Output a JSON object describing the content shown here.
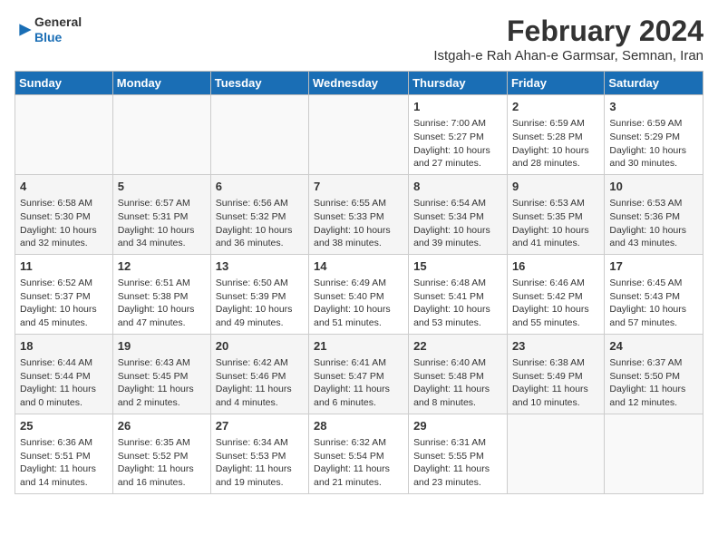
{
  "header": {
    "logo_line1": "General",
    "logo_line2": "Blue",
    "title": "February 2024",
    "subtitle": "Istgah-e Rah Ahan-e Garmsar, Semnan, Iran"
  },
  "weekdays": [
    "Sunday",
    "Monday",
    "Tuesday",
    "Wednesday",
    "Thursday",
    "Friday",
    "Saturday"
  ],
  "weeks": [
    [
      {
        "day": "",
        "info": ""
      },
      {
        "day": "",
        "info": ""
      },
      {
        "day": "",
        "info": ""
      },
      {
        "day": "",
        "info": ""
      },
      {
        "day": "1",
        "info": "Sunrise: 7:00 AM\nSunset: 5:27 PM\nDaylight: 10 hours\nand 27 minutes."
      },
      {
        "day": "2",
        "info": "Sunrise: 6:59 AM\nSunset: 5:28 PM\nDaylight: 10 hours\nand 28 minutes."
      },
      {
        "day": "3",
        "info": "Sunrise: 6:59 AM\nSunset: 5:29 PM\nDaylight: 10 hours\nand 30 minutes."
      }
    ],
    [
      {
        "day": "4",
        "info": "Sunrise: 6:58 AM\nSunset: 5:30 PM\nDaylight: 10 hours\nand 32 minutes."
      },
      {
        "day": "5",
        "info": "Sunrise: 6:57 AM\nSunset: 5:31 PM\nDaylight: 10 hours\nand 34 minutes."
      },
      {
        "day": "6",
        "info": "Sunrise: 6:56 AM\nSunset: 5:32 PM\nDaylight: 10 hours\nand 36 minutes."
      },
      {
        "day": "7",
        "info": "Sunrise: 6:55 AM\nSunset: 5:33 PM\nDaylight: 10 hours\nand 38 minutes."
      },
      {
        "day": "8",
        "info": "Sunrise: 6:54 AM\nSunset: 5:34 PM\nDaylight: 10 hours\nand 39 minutes."
      },
      {
        "day": "9",
        "info": "Sunrise: 6:53 AM\nSunset: 5:35 PM\nDaylight: 10 hours\nand 41 minutes."
      },
      {
        "day": "10",
        "info": "Sunrise: 6:53 AM\nSunset: 5:36 PM\nDaylight: 10 hours\nand 43 minutes."
      }
    ],
    [
      {
        "day": "11",
        "info": "Sunrise: 6:52 AM\nSunset: 5:37 PM\nDaylight: 10 hours\nand 45 minutes."
      },
      {
        "day": "12",
        "info": "Sunrise: 6:51 AM\nSunset: 5:38 PM\nDaylight: 10 hours\nand 47 minutes."
      },
      {
        "day": "13",
        "info": "Sunrise: 6:50 AM\nSunset: 5:39 PM\nDaylight: 10 hours\nand 49 minutes."
      },
      {
        "day": "14",
        "info": "Sunrise: 6:49 AM\nSunset: 5:40 PM\nDaylight: 10 hours\nand 51 minutes."
      },
      {
        "day": "15",
        "info": "Sunrise: 6:48 AM\nSunset: 5:41 PM\nDaylight: 10 hours\nand 53 minutes."
      },
      {
        "day": "16",
        "info": "Sunrise: 6:46 AM\nSunset: 5:42 PM\nDaylight: 10 hours\nand 55 minutes."
      },
      {
        "day": "17",
        "info": "Sunrise: 6:45 AM\nSunset: 5:43 PM\nDaylight: 10 hours\nand 57 minutes."
      }
    ],
    [
      {
        "day": "18",
        "info": "Sunrise: 6:44 AM\nSunset: 5:44 PM\nDaylight: 11 hours\nand 0 minutes."
      },
      {
        "day": "19",
        "info": "Sunrise: 6:43 AM\nSunset: 5:45 PM\nDaylight: 11 hours\nand 2 minutes."
      },
      {
        "day": "20",
        "info": "Sunrise: 6:42 AM\nSunset: 5:46 PM\nDaylight: 11 hours\nand 4 minutes."
      },
      {
        "day": "21",
        "info": "Sunrise: 6:41 AM\nSunset: 5:47 PM\nDaylight: 11 hours\nand 6 minutes."
      },
      {
        "day": "22",
        "info": "Sunrise: 6:40 AM\nSunset: 5:48 PM\nDaylight: 11 hours\nand 8 minutes."
      },
      {
        "day": "23",
        "info": "Sunrise: 6:38 AM\nSunset: 5:49 PM\nDaylight: 11 hours\nand 10 minutes."
      },
      {
        "day": "24",
        "info": "Sunrise: 6:37 AM\nSunset: 5:50 PM\nDaylight: 11 hours\nand 12 minutes."
      }
    ],
    [
      {
        "day": "25",
        "info": "Sunrise: 6:36 AM\nSunset: 5:51 PM\nDaylight: 11 hours\nand 14 minutes."
      },
      {
        "day": "26",
        "info": "Sunrise: 6:35 AM\nSunset: 5:52 PM\nDaylight: 11 hours\nand 16 minutes."
      },
      {
        "day": "27",
        "info": "Sunrise: 6:34 AM\nSunset: 5:53 PM\nDaylight: 11 hours\nand 19 minutes."
      },
      {
        "day": "28",
        "info": "Sunrise: 6:32 AM\nSunset: 5:54 PM\nDaylight: 11 hours\nand 21 minutes."
      },
      {
        "day": "29",
        "info": "Sunrise: 6:31 AM\nSunset: 5:55 PM\nDaylight: 11 hours\nand 23 minutes."
      },
      {
        "day": "",
        "info": ""
      },
      {
        "day": "",
        "info": ""
      }
    ]
  ]
}
